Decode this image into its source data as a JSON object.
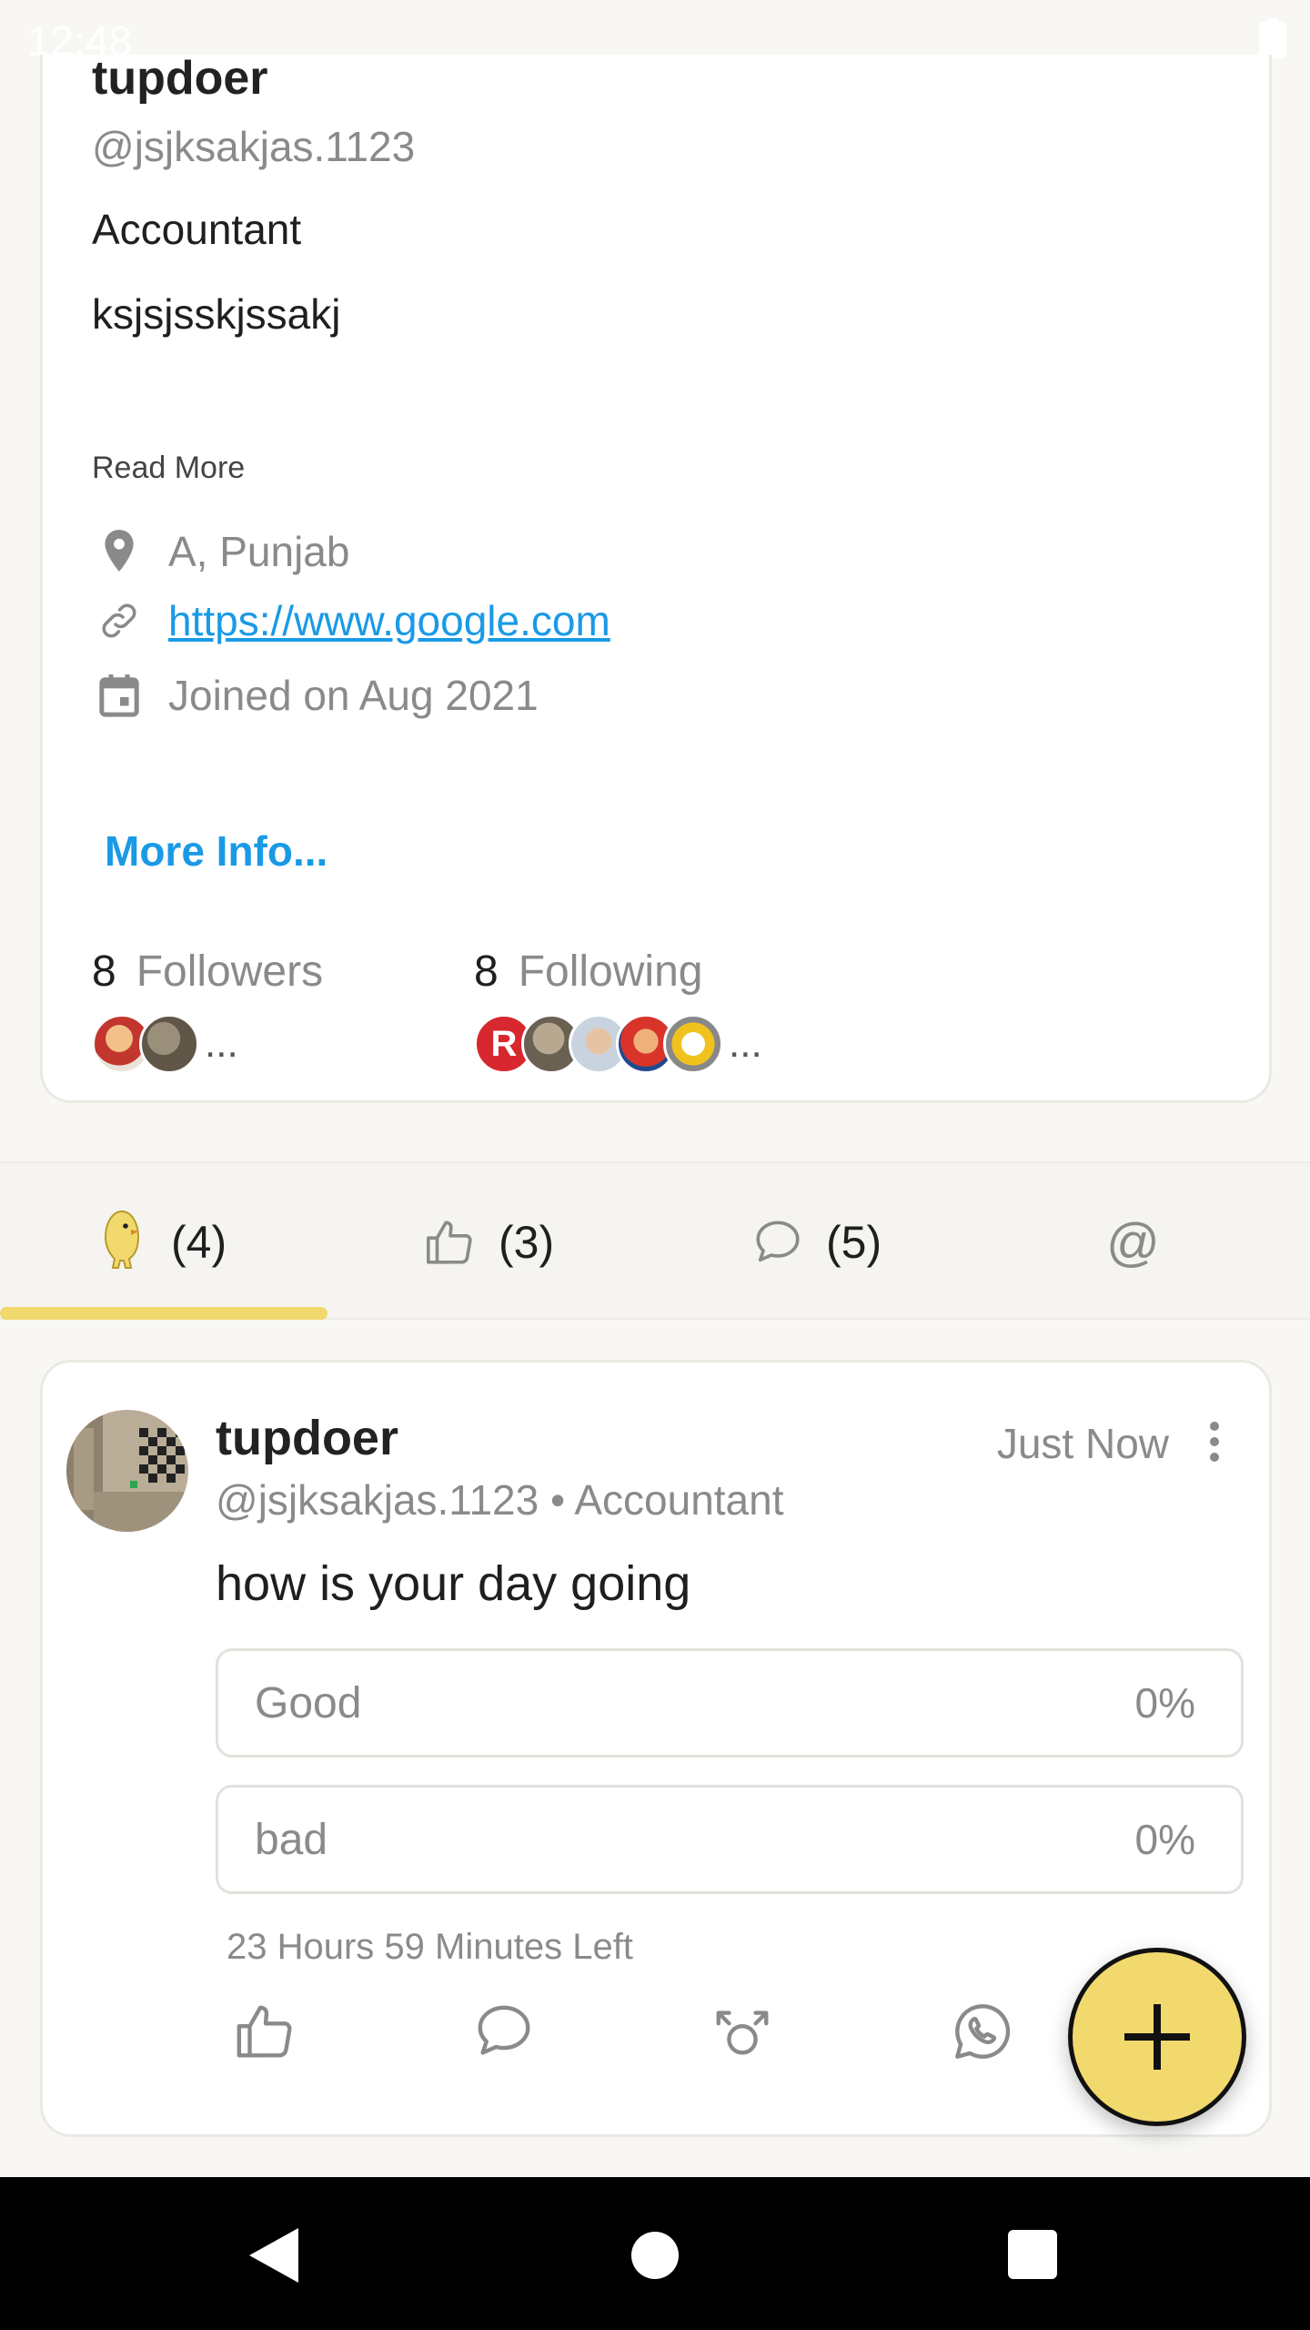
{
  "status_bar": {
    "time": "12:48"
  },
  "profile": {
    "name": "tupdoer",
    "handle": "@jsjksakjas.1123",
    "occupation": "Accountant",
    "bio": "ksjsjsskjssakj",
    "read_more": "Read More",
    "location": "A, Punjab",
    "website": "https://www.google.com",
    "joined": "Joined on Aug 2021",
    "more_info": "More Info...",
    "followers": {
      "count": "8",
      "label": "Followers",
      "more": "..."
    },
    "following": {
      "count": "8",
      "label": "Following",
      "more": "..."
    }
  },
  "tabs": [
    {
      "icon": "koo-bird-icon",
      "label": "(4)"
    },
    {
      "icon": "thumbs-up-icon",
      "label": "(3)"
    },
    {
      "icon": "comment-icon",
      "label": "(5)"
    },
    {
      "icon": "mention-icon",
      "label": "@"
    }
  ],
  "post": {
    "author": "tupdoer",
    "meta": "@jsjksakjas.1123 • Accountant",
    "time": "Just Now",
    "question": "how is your day going",
    "options": [
      {
        "label": "Good",
        "percent": "0%"
      },
      {
        "label": "bad",
        "percent": "0%"
      }
    ],
    "time_left": "23 Hours 59 Minutes Left",
    "actions": [
      "like-icon",
      "comment-icon",
      "rekoo-icon",
      "whatsapp-icon"
    ]
  },
  "colors": {
    "accent_yellow": "#f2d96e",
    "link_blue": "#1a9ae6",
    "muted_text": "#8a8a8a"
  }
}
